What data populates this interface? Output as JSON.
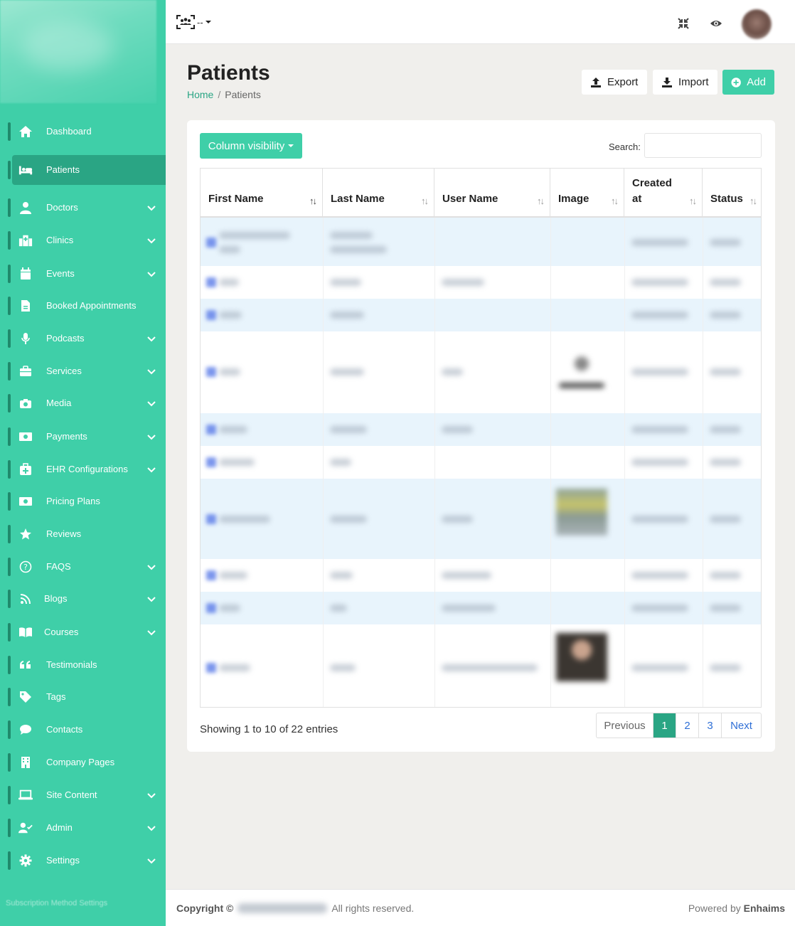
{
  "sidebar": {
    "items": [
      {
        "label": "Dashboard",
        "icon": "home-icon",
        "chevron": false
      },
      {
        "label": "Patients",
        "icon": "bed-icon",
        "chevron": false,
        "active": true
      },
      {
        "label": "Doctors",
        "icon": "user-doctor-icon",
        "chevron": true
      },
      {
        "label": "Clinics",
        "icon": "hospital-icon",
        "chevron": true
      },
      {
        "label": "Events",
        "icon": "calendar-icon",
        "chevron": true
      },
      {
        "label": "Booked Appointments",
        "icon": "file-icon",
        "chevron": false
      },
      {
        "label": "Podcasts",
        "icon": "microphone-icon",
        "chevron": true
      },
      {
        "label": "Services",
        "icon": "briefcase-icon",
        "chevron": true
      },
      {
        "label": "Media",
        "icon": "camera-icon",
        "chevron": true
      },
      {
        "label": "Payments",
        "icon": "money-icon",
        "chevron": true
      },
      {
        "label": "EHR Configurations",
        "icon": "medkit-icon",
        "chevron": true
      },
      {
        "label": "Pricing Plans",
        "icon": "money-bill-icon",
        "chevron": false
      },
      {
        "label": "Reviews",
        "icon": "star-icon",
        "chevron": false
      },
      {
        "label": "FAQS",
        "icon": "question-circle-icon",
        "chevron": true
      },
      {
        "label": "Blogs",
        "icon": "rss-icon",
        "chevron": true
      },
      {
        "label": "Courses",
        "icon": "book-open-icon",
        "chevron": true
      },
      {
        "label": "Testimonials",
        "icon": "quote-icon",
        "chevron": false
      },
      {
        "label": "Tags",
        "icon": "tag-icon",
        "chevron": false
      },
      {
        "label": "Contacts",
        "icon": "comment-icon",
        "chevron": false
      },
      {
        "label": "Company Pages",
        "icon": "building-icon",
        "chevron": false
      },
      {
        "label": "Site Content",
        "icon": "laptop-icon",
        "chevron": true
      },
      {
        "label": "Admin",
        "icon": "user-check-icon",
        "chevron": true
      },
      {
        "label": "Settings",
        "icon": "cog-icon",
        "chevron": true
      }
    ],
    "footer_text": "Subscription Method Settings"
  },
  "topbar": {
    "lang_label": "--",
    "icons": [
      "language-icon",
      "compress-icon",
      "eye-icon",
      "avatar"
    ]
  },
  "header": {
    "title": "Patients",
    "breadcrumb_home": "Home",
    "breadcrumb_sep": "/",
    "breadcrumb_current": "Patients",
    "export_label": "Export",
    "import_label": "Import",
    "add_label": "Add"
  },
  "table": {
    "column_visibility_label": "Column visibility",
    "search_label": "Search:",
    "search_value": "",
    "columns": [
      {
        "label": "First Name",
        "sort": "↑↓"
      },
      {
        "label": "Last Name",
        "sort": "↑↓"
      },
      {
        "label": "User Name",
        "sort": "↑↓"
      },
      {
        "label": "Image",
        "sort": "↑↓"
      },
      {
        "label": "Created at",
        "sort": "↑↓"
      },
      {
        "label": "Status",
        "sort": "↑↓"
      }
    ],
    "info": "Showing 1 to 10 of 22 entries",
    "pagination": {
      "previous": "Previous",
      "pages": [
        "1",
        "2",
        "3"
      ],
      "current": "1",
      "next": "Next"
    }
  },
  "footer": {
    "copyright": "Copyright ©",
    "rights": "All rights reserved.",
    "powered_by": "Powered by",
    "brand": "Enhaims"
  },
  "colors": {
    "sidebar_bg": "#3fcfa8",
    "accent": "#3fcfa8",
    "accent_dark": "#2aa584",
    "link_blue": "#2f6fd6"
  }
}
